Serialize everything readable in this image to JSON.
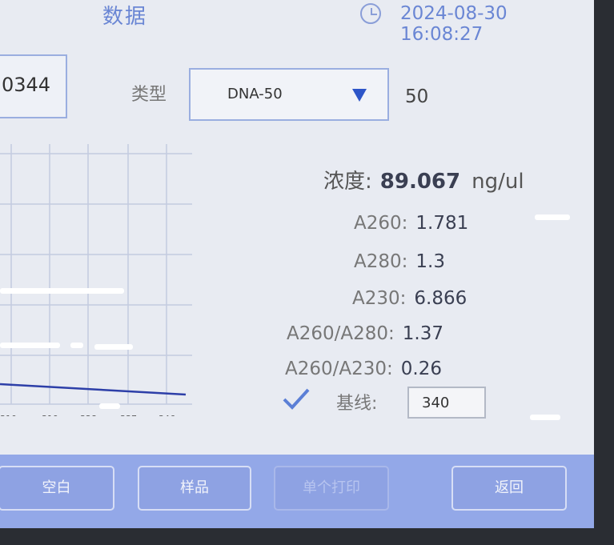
{
  "header": {
    "title": "数据",
    "datetime": "2024-08-30 16:08:27"
  },
  "sample": {
    "id_partial": "0344",
    "type_label": "类型",
    "type_value": "DNA-50",
    "type_factor": "50"
  },
  "results": {
    "concentration_label": "浓度:",
    "concentration_value": "89.067",
    "concentration_unit": "ng/ul",
    "a260_label": "A260:",
    "a260_value": "1.781",
    "a280_label": "A280:",
    "a280_value": "1.3",
    "a230_label": "A230:",
    "a230_value": "6.866",
    "ratio_260_280_label": "A260/A280:",
    "ratio_260_280_value": "1.37",
    "ratio_260_230_label": "A260/A230:",
    "ratio_260_230_value": "0.26",
    "baseline_label": "基线:",
    "baseline_value": "340",
    "baseline_checked": true
  },
  "graph": {
    "x_ticks": [
      "310",
      "319",
      "328",
      "337",
      "346"
    ]
  },
  "buttons": {
    "blank": "空白",
    "sample": "样品",
    "print_single": "单个打印",
    "back": "返回"
  },
  "colors": {
    "accent": "#6a86d4",
    "bar": "#93a8e8",
    "line": "#2d3fa8"
  }
}
